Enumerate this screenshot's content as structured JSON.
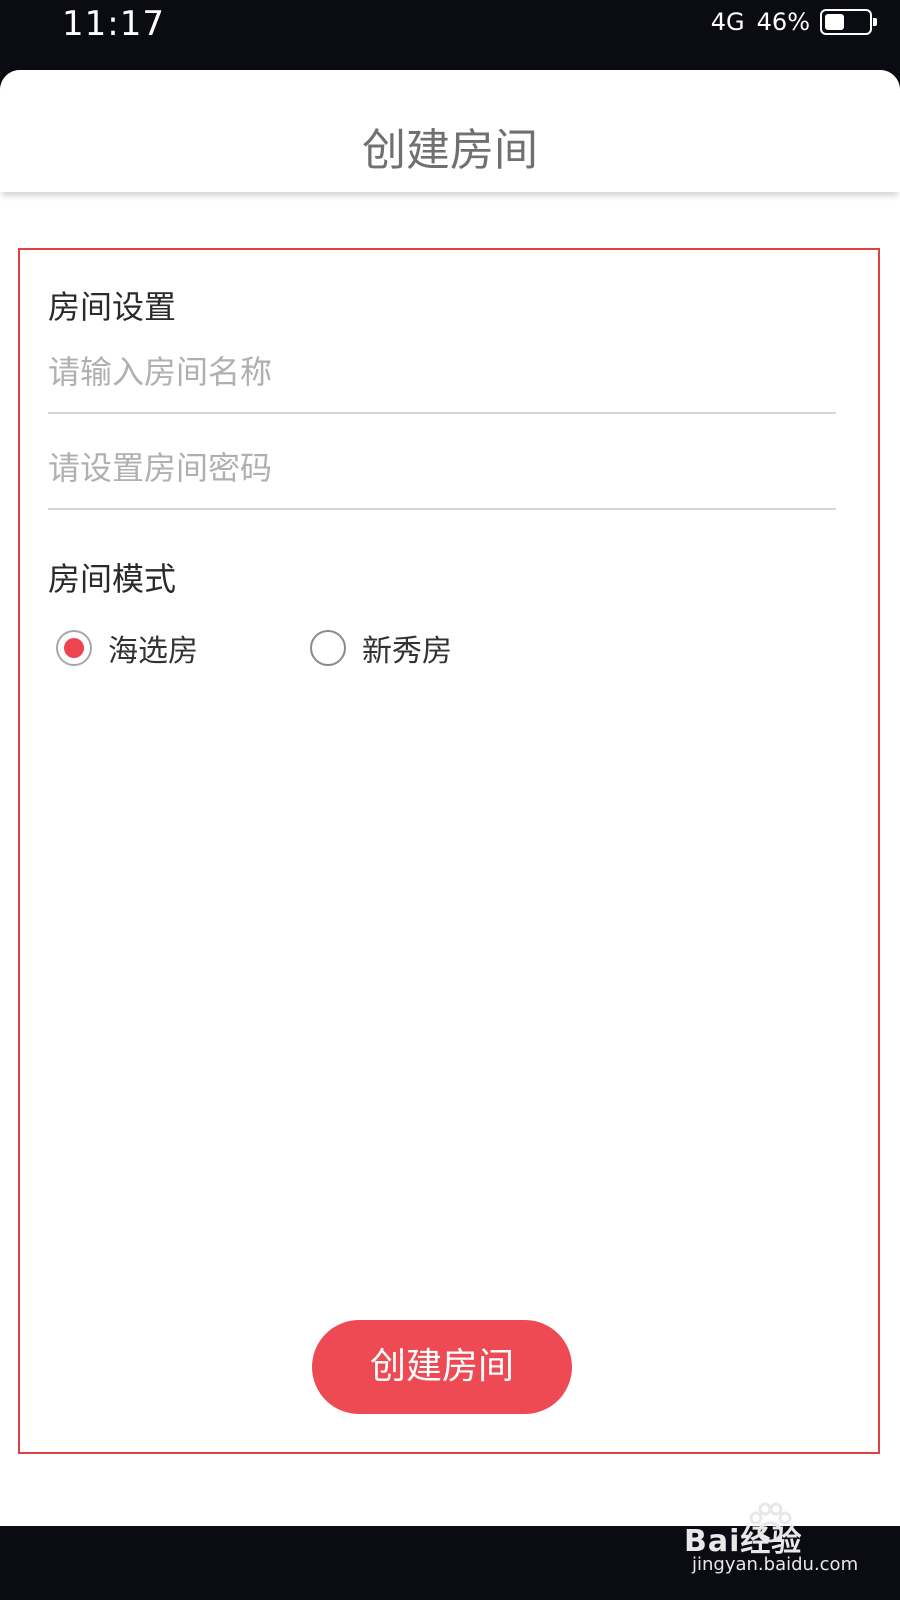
{
  "status_bar": {
    "time": "11:17",
    "network": "4G",
    "battery_text": "46%",
    "battery_level": 0.46
  },
  "header": {
    "title": "创建房间"
  },
  "form": {
    "settings_label": "房间设置",
    "room_name_placeholder": "请输入房间名称",
    "room_password_placeholder": "请设置房间密码",
    "mode_label": "房间模式",
    "mode_options": [
      {
        "label": "海选房",
        "selected": true
      },
      {
        "label": "新秀房",
        "selected": false
      }
    ],
    "submit_label": "创建房间"
  },
  "colors": {
    "accent": "#ee4a54",
    "highlight_border": "#e04040"
  },
  "watermark": {
    "logo_text": "Bai经验",
    "url": "jingyan.baidu.com"
  }
}
